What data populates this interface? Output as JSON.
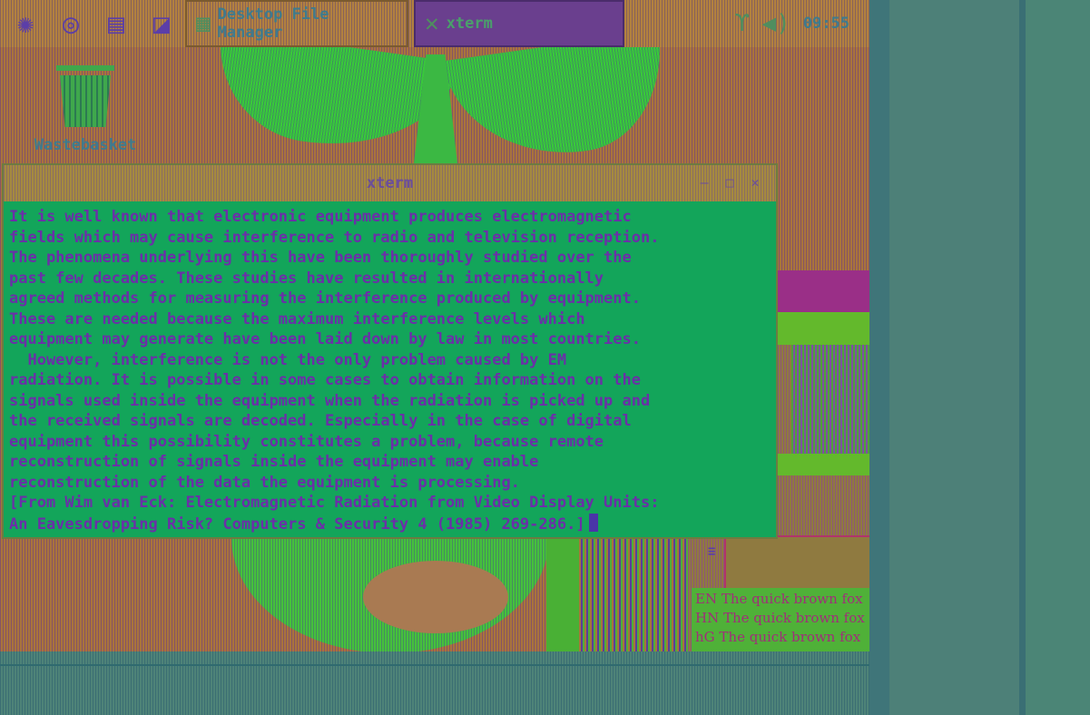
{
  "taskbar": {
    "launchers": [
      {
        "icon": "xfce-mouse-icon"
      },
      {
        "icon": "globe-icon"
      },
      {
        "icon": "file-manager-icon"
      },
      {
        "icon": "terminal-icon"
      }
    ],
    "tasks": [
      {
        "label": "Desktop File Manager",
        "icon": "folder-icon",
        "active": false
      },
      {
        "label": "xterm",
        "icon": "xterm-icon",
        "active": true
      }
    ],
    "clock": "09:55"
  },
  "desktop": {
    "wastebasket_label": "Wastebasket"
  },
  "xterm": {
    "title": "xterm",
    "lines": [
      "It is well known that electronic equipment produces electromagnetic",
      "fields which may cause interference to radio and television reception.",
      "The phenomena underlying this have been thoroughly studied over the",
      "past few decades. These studies have resulted in internationally",
      "agreed methods for measuring the interference produced by equipment.",
      "These are needed because the maximum interference levels which",
      "equipment may generate have been laid down by law in most countries.",
      "  However, interference is not the only problem caused by EM",
      "radiation. It is possible in some cases to obtain information on the",
      "signals used inside the equipment when the radiation is picked up and",
      "the received signals are decoded. Especially in the case of digital",
      "equipment this possibility constitutes a problem, because remote",
      "reconstruction of signals inside the equipment may enable",
      "reconstruction of the data the equipment is processing.",
      "[From Wim van Eck: Electromagnetic Radiation from Video Display Units:",
      "An Eavesdropping Risk? Computers & Security 4 (1985) 269-286.]"
    ]
  },
  "font_samples": [
    "EN The quick brown fox",
    "HN The quick brown fox",
    "hG The quick brown fox"
  ],
  "colors": {
    "terminal_bg": "#13a55a",
    "terminal_text": "#6b2fa8",
    "desktop_bg": "#a9743c"
  }
}
